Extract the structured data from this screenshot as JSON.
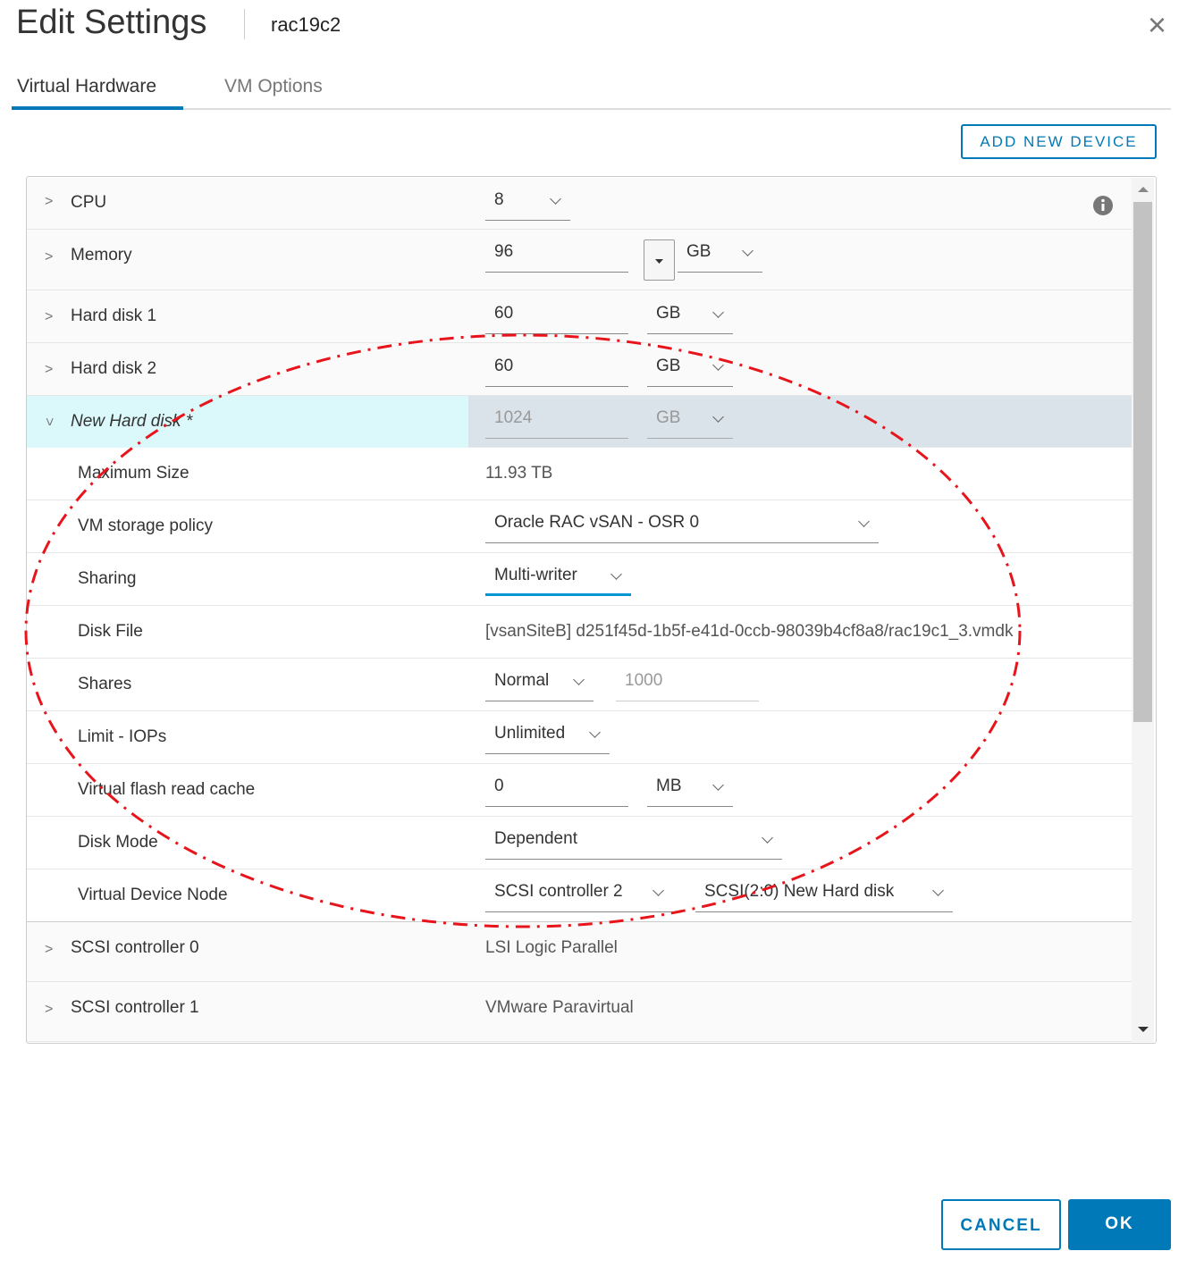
{
  "header": {
    "title": "Edit Settings",
    "vm_name": "rac19c2",
    "close": "×"
  },
  "tabs": [
    {
      "label": "Virtual Hardware"
    },
    {
      "label": "VM Options"
    }
  ],
  "add_device": "ADD NEW DEVICE",
  "rows": {
    "cpu": {
      "label": "CPU",
      "value": "8"
    },
    "memory": {
      "label": "Memory",
      "value": "96",
      "unit": "GB"
    },
    "hd1": {
      "label": "Hard disk 1",
      "value": "60",
      "unit": "GB"
    },
    "hd2": {
      "label": "Hard disk 2",
      "value": "60",
      "unit": "GB"
    },
    "newhd": {
      "label": "New Hard disk *",
      "value": "1024",
      "unit": "GB"
    },
    "maxsize": {
      "label": "Maximum Size",
      "value": "11.93 TB"
    },
    "policy": {
      "label": "VM storage policy",
      "value": "Oracle RAC vSAN - OSR 0"
    },
    "sharing": {
      "label": "Sharing",
      "value": "Multi-writer"
    },
    "diskfile": {
      "label": "Disk File",
      "value": "[vsanSiteB] d251f45d-1b5f-e41d-0ccb-98039b4cf8a8/rac19c1_3.vmdk"
    },
    "shares": {
      "label": "Shares",
      "value": "Normal",
      "number": "1000"
    },
    "limit": {
      "label": "Limit - IOPs",
      "value": "Unlimited"
    },
    "flash": {
      "label": "Virtual flash read cache",
      "value": "0",
      "unit": "MB"
    },
    "diskmode": {
      "label": "Disk Mode",
      "value": "Dependent"
    },
    "vdn": {
      "label": "Virtual Device Node",
      "controller": "SCSI controller 2",
      "node": "SCSI(2:0) New Hard disk"
    },
    "scsi0": {
      "label": "SCSI controller 0",
      "value": "LSI Logic Parallel"
    },
    "scsi1": {
      "label": "SCSI controller 1",
      "value": "VMware Paravirtual"
    }
  },
  "footer": {
    "cancel": "CANCEL",
    "ok": "OK"
  },
  "colors": {
    "accent": "#0079b8",
    "annotation": "#e8141b"
  }
}
